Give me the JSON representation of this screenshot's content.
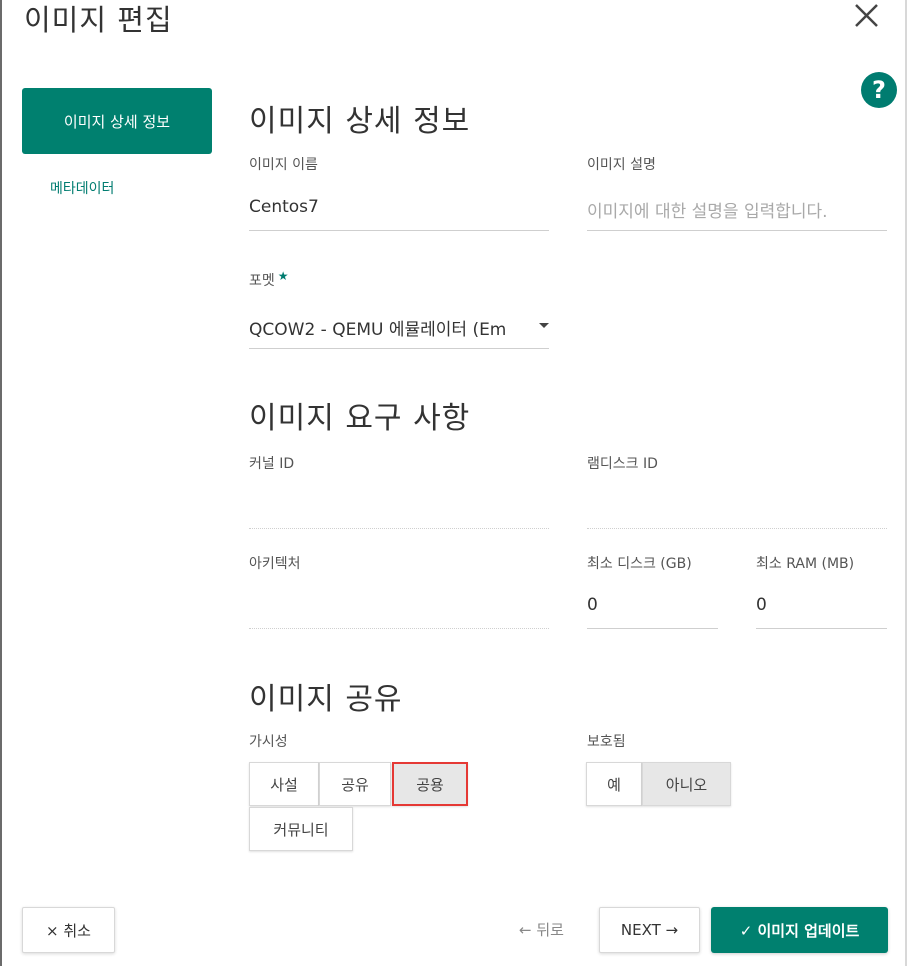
{
  "modal": {
    "title": "이미지 편집"
  },
  "icons": {
    "close": "close-icon",
    "help": "help-icon",
    "help_glyph": "?"
  },
  "colors": {
    "accent": "#00806f",
    "highlight": "#e53935"
  },
  "nav": {
    "items": [
      {
        "label": "이미지 상세 정보",
        "active": true
      },
      {
        "label": "메타데이터",
        "active": false
      }
    ]
  },
  "details": {
    "heading": "이미지 상세 정보",
    "name_label": "이미지 이름",
    "name_value": "Centos7",
    "desc_label": "이미지 설명",
    "desc_placeholder": "이미지에 대한 설명을 입력합니다.",
    "format_label": "포멧",
    "format_required_mark": "★",
    "format_value": "QCOW2 - QEMU 에뮬레이터 (Em"
  },
  "requirements": {
    "heading": "이미지 요구 사항",
    "kernel_label": "커널 ID",
    "kernel_value": "",
    "ramdisk_label": "램디스크 ID",
    "ramdisk_value": "",
    "arch_label": "아키텍처",
    "arch_value": "",
    "min_disk_label": "최소 디스크 (GB)",
    "min_disk_value": "0",
    "min_ram_label": "최소 RAM (MB)",
    "min_ram_value": "0"
  },
  "sharing": {
    "heading": "이미지 공유",
    "visibility_label": "가시성",
    "visibility_options": [
      "사설",
      "공유",
      "공용",
      "커뮤니티"
    ],
    "visibility_selected": "공용",
    "protected_label": "보호됨",
    "protected_options": [
      "예",
      "아니오"
    ],
    "protected_selected": "아니오"
  },
  "footer": {
    "cancel": "× 취소",
    "back": "← 뒤로",
    "next": "NEXT →",
    "submit": "✓ 이미지 업데이트"
  }
}
